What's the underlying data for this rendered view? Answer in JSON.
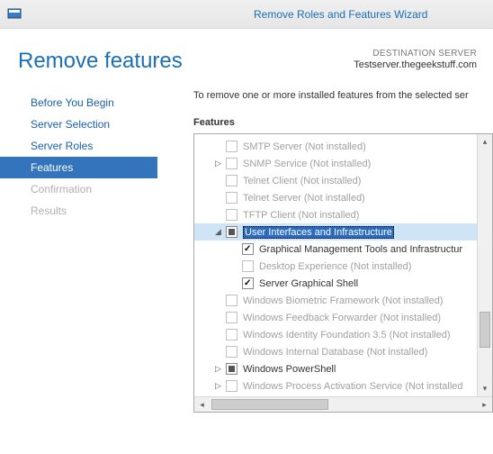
{
  "window_title": "Remove Roles and Features Wizard",
  "page_title": "Remove features",
  "destination": {
    "label": "DESTINATION SERVER",
    "name": "Testserver.thegeekstuff.com"
  },
  "nav": [
    {
      "label": "Before You Begin",
      "state": "normal"
    },
    {
      "label": "Server Selection",
      "state": "normal"
    },
    {
      "label": "Server Roles",
      "state": "normal"
    },
    {
      "label": "Features",
      "state": "active"
    },
    {
      "label": "Confirmation",
      "state": "disabled"
    },
    {
      "label": "Results",
      "state": "disabled"
    }
  ],
  "instruction": "To remove one or more installed features from the selected ser",
  "features_label": "Features",
  "tree": [
    {
      "label": "SMTP Server (Not installed)",
      "check": "empty",
      "disabled": true,
      "indent": 1,
      "expander": ""
    },
    {
      "label": "SNMP Service (Not installed)",
      "check": "empty",
      "disabled": true,
      "indent": 1,
      "expander": "▷"
    },
    {
      "label": "Telnet Client (Not installed)",
      "check": "empty",
      "disabled": true,
      "indent": 1,
      "expander": ""
    },
    {
      "label": "Telnet Server (Not installed)",
      "check": "empty",
      "disabled": true,
      "indent": 1,
      "expander": ""
    },
    {
      "label": "TFTP Client (Not installed)",
      "check": "empty",
      "disabled": true,
      "indent": 1,
      "expander": ""
    },
    {
      "label": "User Interfaces and Infrastructure",
      "check": "partial",
      "disabled": false,
      "indent": 1,
      "expander": "◢",
      "selected": true,
      "highlight": true
    },
    {
      "label": "Graphical Management Tools and Infrastructur",
      "check": "checked",
      "disabled": false,
      "indent": 2,
      "expander": ""
    },
    {
      "label": "Desktop Experience (Not installed)",
      "check": "empty",
      "disabled": true,
      "indent": 2,
      "expander": ""
    },
    {
      "label": "Server Graphical Shell",
      "check": "checked",
      "disabled": false,
      "indent": 2,
      "expander": ""
    },
    {
      "label": "Windows Biometric Framework (Not installed)",
      "check": "empty",
      "disabled": true,
      "indent": 1,
      "expander": ""
    },
    {
      "label": "Windows Feedback Forwarder (Not installed)",
      "check": "empty",
      "disabled": true,
      "indent": 1,
      "expander": ""
    },
    {
      "label": "Windows Identity Foundation 3.5 (Not installed)",
      "check": "empty",
      "disabled": true,
      "indent": 1,
      "expander": ""
    },
    {
      "label": "Windows Internal Database (Not installed)",
      "check": "empty",
      "disabled": true,
      "indent": 1,
      "expander": ""
    },
    {
      "label": "Windows PowerShell",
      "check": "partial",
      "disabled": false,
      "indent": 1,
      "expander": "▷"
    },
    {
      "label": "Windows Process Activation Service (Not installed",
      "check": "empty",
      "disabled": true,
      "indent": 1,
      "expander": "▷"
    }
  ]
}
